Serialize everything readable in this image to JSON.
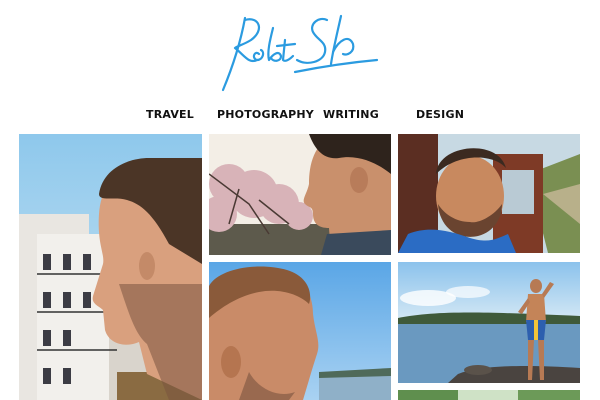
{
  "site": {
    "signature_color": "#2b9be0"
  },
  "nav": {
    "items": [
      {
        "label": "TRAVEL"
      },
      {
        "label": "PHOTOGRAPHY"
      },
      {
        "label": "WRITING"
      },
      {
        "label": "DESIGN"
      }
    ]
  },
  "gallery": {
    "photos": [
      {
        "name": "portrait-profile-city-photo"
      },
      {
        "name": "cherry-blossom-portrait-photo"
      },
      {
        "name": "train-window-selfie-photo"
      },
      {
        "name": "sky-portrait-photo"
      },
      {
        "name": "lake-shore-photo"
      }
    ]
  }
}
